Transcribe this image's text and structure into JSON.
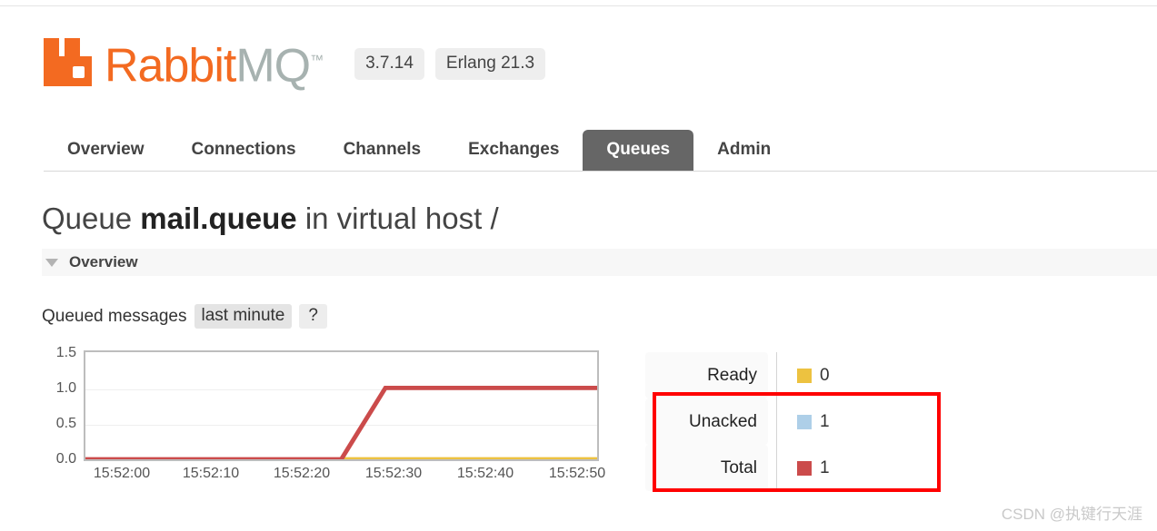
{
  "brand": {
    "name_primary": "Rabbit",
    "name_secondary": "MQ",
    "trademark": "™",
    "logo_color": "#f36a21",
    "secondary_color": "#a7b2b0"
  },
  "badges": [
    {
      "label": "3.7.14"
    },
    {
      "label": "Erlang 21.3"
    }
  ],
  "nav": {
    "tabs": [
      {
        "label": "Overview",
        "active": false
      },
      {
        "label": "Connections",
        "active": false
      },
      {
        "label": "Channels",
        "active": false
      },
      {
        "label": "Exchanges",
        "active": false
      },
      {
        "label": "Queues",
        "active": true
      },
      {
        "label": "Admin",
        "active": false
      }
    ],
    "active_color": "#666666"
  },
  "title": {
    "prefix": "Queue",
    "queue_name": "mail.queue",
    "suffix": "in virtual host",
    "vhost": "/"
  },
  "section": {
    "overview_label": "Overview",
    "caret_icon": "triangle-down-icon"
  },
  "chart_controls": {
    "label": "Queued messages",
    "range_chip": "last minute",
    "help_chip": "?"
  },
  "legend": {
    "rows": [
      {
        "label": "Ready",
        "value": "0",
        "color": "#edc240",
        "highlighted": false
      },
      {
        "label": "Unacked",
        "value": "1",
        "color": "#aecfe8",
        "highlighted": true
      },
      {
        "label": "Total",
        "value": "1",
        "color": "#cb4b4b",
        "highlighted": true
      }
    ]
  },
  "annotation": {
    "color": "#ff0000",
    "covers": "Unacked and Total rows"
  },
  "watermark": {
    "text": "CSDN @执键行天涯"
  },
  "chart_data": {
    "type": "line",
    "title": "Queued messages",
    "xlabel": "",
    "ylabel": "",
    "ylim": [
      0,
      1.5
    ],
    "yticks": [
      "0.0",
      "0.5",
      "1.0",
      "1.5"
    ],
    "ytick_values": [
      0.0,
      0.5,
      1.0,
      1.5
    ],
    "xticks": [
      "15:52:00",
      "15:52:10",
      "15:52:20",
      "15:52:30",
      "15:52:40",
      "15:52:50"
    ],
    "xtick_values": [
      0,
      10,
      20,
      30,
      40,
      50
    ],
    "xlim": [
      0,
      58
    ],
    "grid": true,
    "legend_position": "right",
    "series": [
      {
        "name": "Total",
        "color": "#cb4b4b",
        "x": [
          0,
          29,
          34,
          58
        ],
        "values": [
          0,
          0,
          1,
          1
        ]
      },
      {
        "name": "Ready",
        "color": "#edc240",
        "x": [
          29,
          58
        ],
        "values": [
          0,
          0
        ]
      }
    ]
  }
}
